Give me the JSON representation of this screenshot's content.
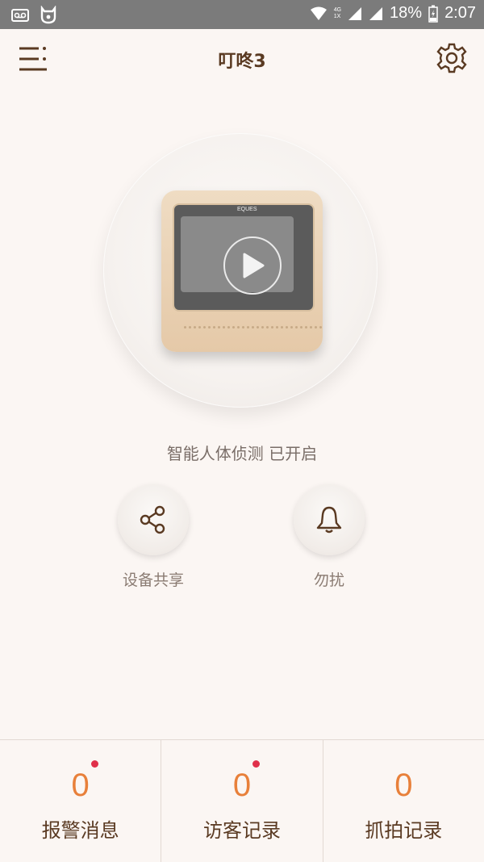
{
  "status_bar": {
    "battery": "18%",
    "time": "2:07",
    "network_small": "4G",
    "network_small2": "1X"
  },
  "header": {
    "title": "叮咚3"
  },
  "device": {
    "brand": "EQUES"
  },
  "motion_status": "智能人体侦测 已开启",
  "actions": [
    {
      "label": "设备共享",
      "icon": "share-icon"
    },
    {
      "label": "勿扰",
      "icon": "bell-icon"
    }
  ],
  "tabs": [
    {
      "count": "0",
      "label": "报警消息",
      "has_badge": true
    },
    {
      "count": "0",
      "label": "访客记录",
      "has_badge": true
    },
    {
      "count": "0",
      "label": "抓拍记录",
      "has_badge": false
    }
  ],
  "colors": {
    "accent_orange": "#e8803a",
    "brown": "#5a3a22",
    "badge_red": "#e0304a"
  }
}
